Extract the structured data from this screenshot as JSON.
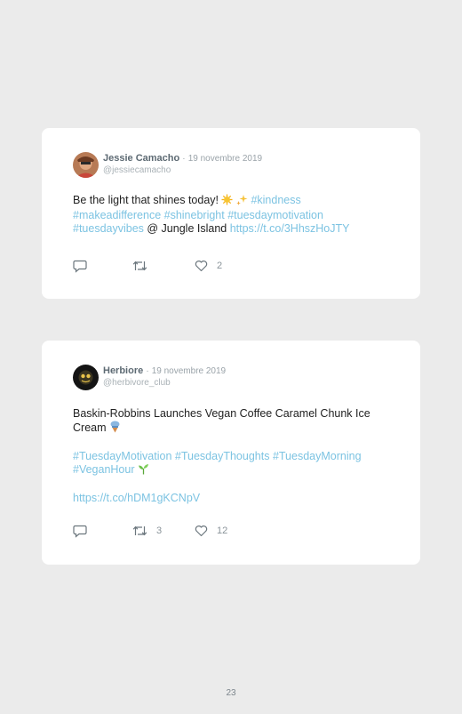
{
  "tweets": [
    {
      "author": "Jessie Camacho",
      "separator": "·",
      "date": "19 novembre 2019",
      "handle": "@jessiecamacho",
      "text_start": "Be the light that shines today! ",
      "emoji_1": "sun-emoji",
      "emoji_2": "sparkle-emoji",
      "tags_line": [
        "#kindness",
        "#makeadifference",
        "#shinebright",
        "#tuesdaymotivation",
        "#tuesdayvibes"
      ],
      "location_text": " @ Jungle Island ",
      "link": "https://t.co/3HhszHoJTY",
      "retweets": "",
      "likes": "2"
    },
    {
      "author": "Herbiore",
      "separator": "·",
      "date": "19 novembre 2019",
      "handle": "@herbivore_club",
      "text_start": "Baskin-Robbins Launches Vegan Coffee Caramel Chunk Ice Cream ",
      "emoji_1": "ice-cream-emoji",
      "tags": [
        "#TuesdayMotivation",
        "#TuesdayThoughts",
        "#TuesdayMorning",
        "#VeganHour"
      ],
      "emoji_2": "seedling-emoji",
      "link": "https://t.co/hDM1gKCNpV",
      "retweets": "3",
      "likes": "12"
    }
  ],
  "page_number": "23",
  "colors": {
    "background": "#ebebeb",
    "card": "#ffffff",
    "hashtag": "#7cc3e2",
    "author": "#5d6a73"
  }
}
